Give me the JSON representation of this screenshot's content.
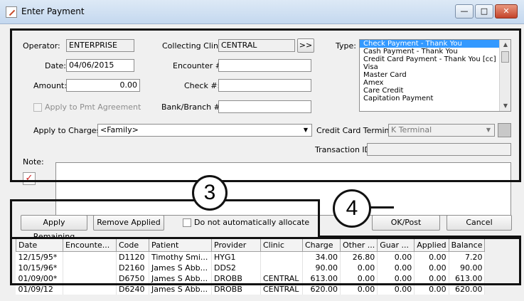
{
  "window": {
    "title": "Enter Payment"
  },
  "form": {
    "operator_label": "Operator:",
    "operator_value": "ENTERPRISE",
    "collecting_clinic_label": "Collecting Clinic:",
    "collecting_clinic_value": "CENTRAL",
    "more_button": ">>",
    "type_label": "Type:",
    "date_label": "Date:",
    "date_value": "04/06/2015",
    "encounter_label": "Encounter #:",
    "encounter_value": "",
    "amount_label": "Amount:",
    "amount_value": "0.00",
    "check_label": "Check #:",
    "check_value": "",
    "apply_pmt_label": "Apply to Pmt Agreement",
    "bank_label": "Bank/Branch #:",
    "bank_value": "",
    "apply_charges_label": "Apply to Charges",
    "apply_charges_value": "<Family>",
    "cc_terminal_label": "Credit Card Terminal:",
    "cc_terminal_value": "K Terminal",
    "transaction_label": "Transaction ID:",
    "transaction_value": "",
    "note_label": "Note:",
    "note_value": ""
  },
  "types": [
    "Check Payment - Thank You",
    "Cash Payment - Thank You",
    "Credit Card Payment - Thank You [cc]",
    "Visa",
    "Master Card",
    "Amex",
    "Care Credit",
    "Capitation Payment"
  ],
  "buttons": {
    "apply_remaining": "Apply Remaining",
    "remove_applied": "Remove Applied",
    "no_auto_allocate": "Do not automatically allocate",
    "ok_post": "OK/Post",
    "cancel": "Cancel"
  },
  "callouts": {
    "c3": "3",
    "c4": "4"
  },
  "charges": {
    "columns": [
      "Date",
      "Encounte...",
      "Code",
      "Patient",
      "Provider",
      "Clinic",
      "Charge",
      "Other ...",
      "Guar ...",
      "Applied",
      "Balance"
    ],
    "rows": [
      [
        "12/15/95*",
        "",
        "D1120",
        "Timothy Smi...",
        "HYG1",
        "",
        "34.00",
        "26.80",
        "0.00",
        "0.00",
        "7.20"
      ],
      [
        "10/15/96*",
        "",
        "D2160",
        "James S Abb...",
        "DDS2",
        "",
        "90.00",
        "0.00",
        "0.00",
        "0.00",
        "90.00"
      ],
      [
        "01/09/00*",
        "",
        "D6750",
        "James S Abb...",
        "DROBB",
        "CENTRAL",
        "613.00",
        "0.00",
        "0.00",
        "0.00",
        "613.00"
      ],
      [
        "01/09/12",
        "",
        "D6240",
        "James S Abb...",
        "DROBB",
        "CENTRAL",
        "620.00",
        "0.00",
        "0.00",
        "0.00",
        "620.00"
      ]
    ]
  },
  "colors": {
    "callout_border": "#111111",
    "selection": "#3399ff",
    "title_gradient_top": "#dde9f6"
  }
}
